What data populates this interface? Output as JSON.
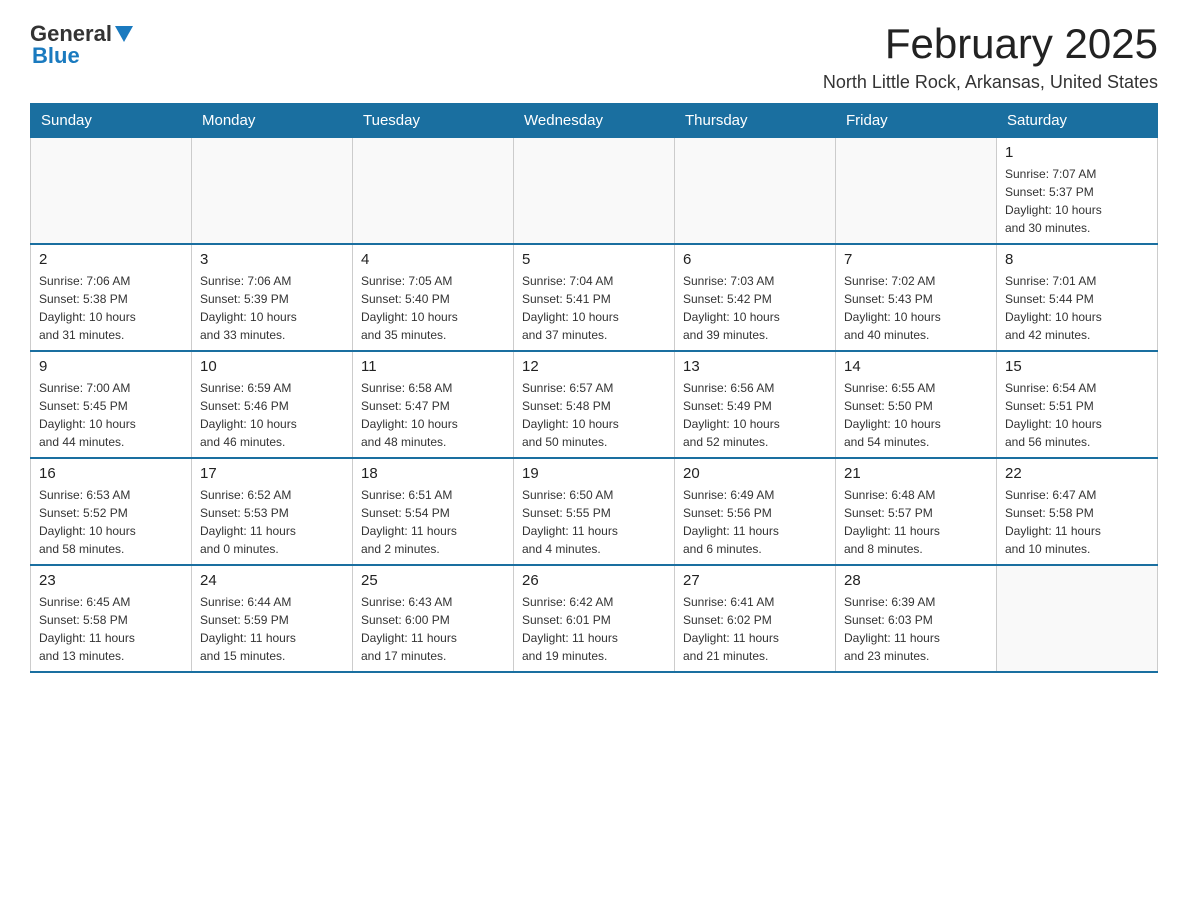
{
  "logo": {
    "general": "General",
    "blue": "Blue"
  },
  "header": {
    "month": "February 2025",
    "location": "North Little Rock, Arkansas, United States"
  },
  "weekdays": [
    "Sunday",
    "Monday",
    "Tuesday",
    "Wednesday",
    "Thursday",
    "Friday",
    "Saturday"
  ],
  "weeks": [
    [
      {
        "day": "",
        "info": ""
      },
      {
        "day": "",
        "info": ""
      },
      {
        "day": "",
        "info": ""
      },
      {
        "day": "",
        "info": ""
      },
      {
        "day": "",
        "info": ""
      },
      {
        "day": "",
        "info": ""
      },
      {
        "day": "1",
        "info": "Sunrise: 7:07 AM\nSunset: 5:37 PM\nDaylight: 10 hours\nand 30 minutes."
      }
    ],
    [
      {
        "day": "2",
        "info": "Sunrise: 7:06 AM\nSunset: 5:38 PM\nDaylight: 10 hours\nand 31 minutes."
      },
      {
        "day": "3",
        "info": "Sunrise: 7:06 AM\nSunset: 5:39 PM\nDaylight: 10 hours\nand 33 minutes."
      },
      {
        "day": "4",
        "info": "Sunrise: 7:05 AM\nSunset: 5:40 PM\nDaylight: 10 hours\nand 35 minutes."
      },
      {
        "day": "5",
        "info": "Sunrise: 7:04 AM\nSunset: 5:41 PM\nDaylight: 10 hours\nand 37 minutes."
      },
      {
        "day": "6",
        "info": "Sunrise: 7:03 AM\nSunset: 5:42 PM\nDaylight: 10 hours\nand 39 minutes."
      },
      {
        "day": "7",
        "info": "Sunrise: 7:02 AM\nSunset: 5:43 PM\nDaylight: 10 hours\nand 40 minutes."
      },
      {
        "day": "8",
        "info": "Sunrise: 7:01 AM\nSunset: 5:44 PM\nDaylight: 10 hours\nand 42 minutes."
      }
    ],
    [
      {
        "day": "9",
        "info": "Sunrise: 7:00 AM\nSunset: 5:45 PM\nDaylight: 10 hours\nand 44 minutes."
      },
      {
        "day": "10",
        "info": "Sunrise: 6:59 AM\nSunset: 5:46 PM\nDaylight: 10 hours\nand 46 minutes."
      },
      {
        "day": "11",
        "info": "Sunrise: 6:58 AM\nSunset: 5:47 PM\nDaylight: 10 hours\nand 48 minutes."
      },
      {
        "day": "12",
        "info": "Sunrise: 6:57 AM\nSunset: 5:48 PM\nDaylight: 10 hours\nand 50 minutes."
      },
      {
        "day": "13",
        "info": "Sunrise: 6:56 AM\nSunset: 5:49 PM\nDaylight: 10 hours\nand 52 minutes."
      },
      {
        "day": "14",
        "info": "Sunrise: 6:55 AM\nSunset: 5:50 PM\nDaylight: 10 hours\nand 54 minutes."
      },
      {
        "day": "15",
        "info": "Sunrise: 6:54 AM\nSunset: 5:51 PM\nDaylight: 10 hours\nand 56 minutes."
      }
    ],
    [
      {
        "day": "16",
        "info": "Sunrise: 6:53 AM\nSunset: 5:52 PM\nDaylight: 10 hours\nand 58 minutes."
      },
      {
        "day": "17",
        "info": "Sunrise: 6:52 AM\nSunset: 5:53 PM\nDaylight: 11 hours\nand 0 minutes."
      },
      {
        "day": "18",
        "info": "Sunrise: 6:51 AM\nSunset: 5:54 PM\nDaylight: 11 hours\nand 2 minutes."
      },
      {
        "day": "19",
        "info": "Sunrise: 6:50 AM\nSunset: 5:55 PM\nDaylight: 11 hours\nand 4 minutes."
      },
      {
        "day": "20",
        "info": "Sunrise: 6:49 AM\nSunset: 5:56 PM\nDaylight: 11 hours\nand 6 minutes."
      },
      {
        "day": "21",
        "info": "Sunrise: 6:48 AM\nSunset: 5:57 PM\nDaylight: 11 hours\nand 8 minutes."
      },
      {
        "day": "22",
        "info": "Sunrise: 6:47 AM\nSunset: 5:58 PM\nDaylight: 11 hours\nand 10 minutes."
      }
    ],
    [
      {
        "day": "23",
        "info": "Sunrise: 6:45 AM\nSunset: 5:58 PM\nDaylight: 11 hours\nand 13 minutes."
      },
      {
        "day": "24",
        "info": "Sunrise: 6:44 AM\nSunset: 5:59 PM\nDaylight: 11 hours\nand 15 minutes."
      },
      {
        "day": "25",
        "info": "Sunrise: 6:43 AM\nSunset: 6:00 PM\nDaylight: 11 hours\nand 17 minutes."
      },
      {
        "day": "26",
        "info": "Sunrise: 6:42 AM\nSunset: 6:01 PM\nDaylight: 11 hours\nand 19 minutes."
      },
      {
        "day": "27",
        "info": "Sunrise: 6:41 AM\nSunset: 6:02 PM\nDaylight: 11 hours\nand 21 minutes."
      },
      {
        "day": "28",
        "info": "Sunrise: 6:39 AM\nSunset: 6:03 PM\nDaylight: 11 hours\nand 23 minutes."
      },
      {
        "day": "",
        "info": ""
      }
    ]
  ]
}
